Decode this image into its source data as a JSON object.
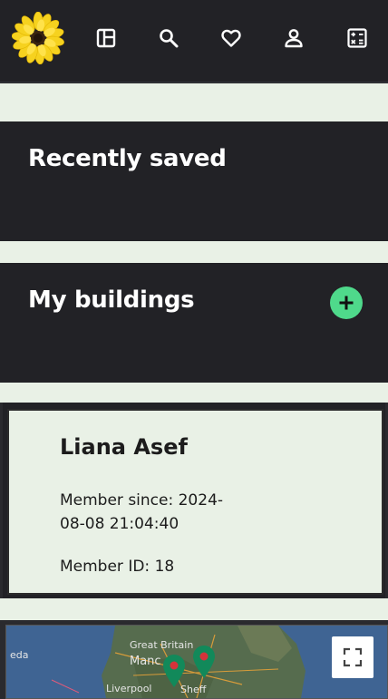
{
  "nav": {
    "logo": "sunflower-logo",
    "items": [
      {
        "icon": "dashboard-icon"
      },
      {
        "icon": "search-icon"
      },
      {
        "icon": "heart-icon"
      },
      {
        "icon": "person-icon"
      },
      {
        "icon": "calculator-icon"
      }
    ]
  },
  "sections": {
    "recently_saved": {
      "title": "Recently saved"
    },
    "my_buildings": {
      "title": "My buildings",
      "add_icon": "plus-icon"
    }
  },
  "profile": {
    "name": "Liana Asef",
    "member_since": "Member since: 2024-08-08 21:04:40",
    "member_id": "Member ID: 18"
  },
  "map": {
    "labels": [
      "Great Britain",
      "Manc",
      "Liverpool",
      "Sheff",
      "eda"
    ],
    "fullscreen_icon": "fullscreen-icon"
  },
  "colors": {
    "panel_dark": "#222226",
    "strip_light": "#e9f1e6",
    "accent_green": "#4fd98b",
    "logo_petals": "#f6d21f"
  }
}
